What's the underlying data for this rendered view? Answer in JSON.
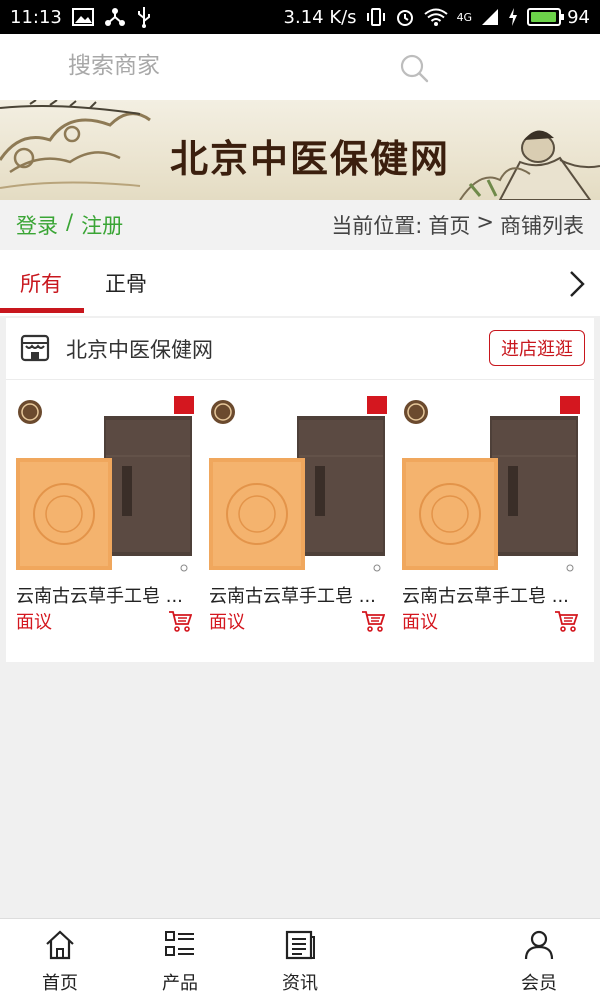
{
  "status_bar": {
    "time": "11:13",
    "speed": "3.14 K/s",
    "network": "4G",
    "battery": "94",
    "battery_level": 0.94,
    "battery_color": "#6cd34a"
  },
  "search": {
    "placeholder": "搜索商家",
    "icon": "search-icon"
  },
  "banner": {
    "title": "北京中医保健网"
  },
  "breadcrumb": {
    "login": "登录",
    "separator": "/",
    "register": "注册",
    "current_position": "当前位置:",
    "home": "首页",
    "arrow": ">",
    "page": "商铺列表"
  },
  "tabs": {
    "items": [
      {
        "label": "所有",
        "active": true
      },
      {
        "label": "正骨",
        "active": false
      }
    ],
    "next_icon": "chevron-right-icon",
    "active_color": "#c8161d"
  },
  "shop": {
    "icon": "store-icon",
    "name": "北京中医保健网",
    "enter_button": "进店逛逛",
    "products": [
      {
        "name": "云南古云草手工皂 ...",
        "price": "面议",
        "cart_icon": "cart-icon"
      },
      {
        "name": "云南古云草手工皂 ...",
        "price": "面议",
        "cart_icon": "cart-icon"
      },
      {
        "name": "云南古云草手工皂 ...",
        "price": "面议",
        "cart_icon": "cart-icon"
      }
    ]
  },
  "bottom_nav": {
    "items": [
      {
        "label": "首页",
        "icon": "home-icon"
      },
      {
        "label": "产品",
        "icon": "list-icon"
      },
      {
        "label": "资讯",
        "icon": "news-icon"
      },
      {
        "label": "会员",
        "icon": "user-icon"
      }
    ]
  }
}
